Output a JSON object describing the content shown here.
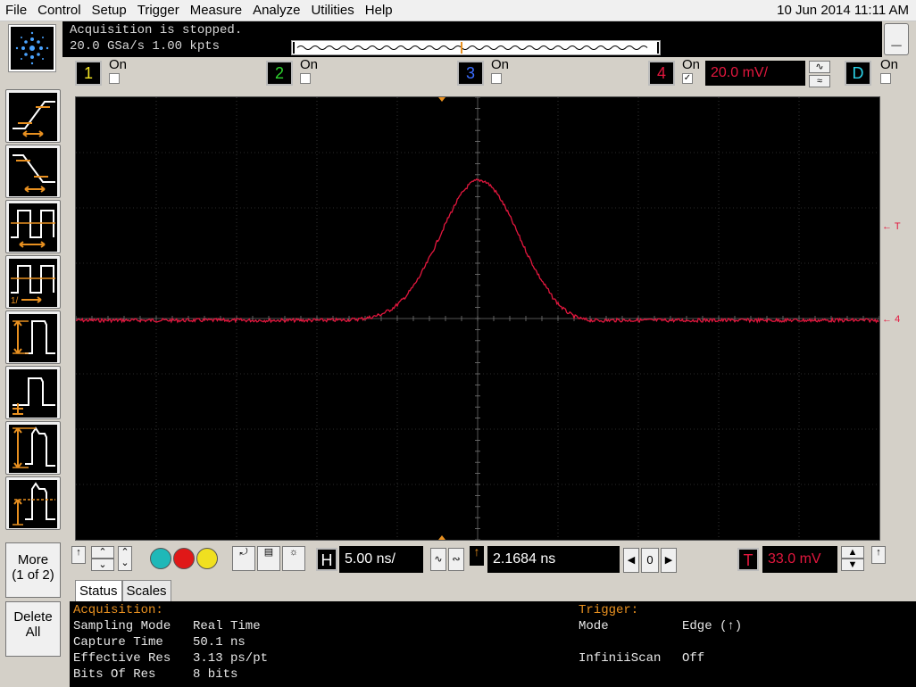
{
  "menubar": {
    "items": [
      "File",
      "Control",
      "Setup",
      "Trigger",
      "Measure",
      "Analyze",
      "Utilities",
      "Help"
    ],
    "datetime": "10 Jun 2014 11:11 AM"
  },
  "acquisition_strip": {
    "status": "Acquisition is stopped.",
    "rate": "20.0 GSa/s   1.00 kpts"
  },
  "channels": [
    {
      "id": "1",
      "label": "On",
      "checked": false,
      "color": "#f5e625"
    },
    {
      "id": "2",
      "label": "On",
      "checked": false,
      "color": "#2fd62f"
    },
    {
      "id": "3",
      "label": "On",
      "checked": false,
      "color": "#3a6cff"
    },
    {
      "id": "4",
      "label": "On",
      "checked": true,
      "color": "#e3173e",
      "scale": "20.0 mV/"
    },
    {
      "id": "D",
      "label": "On",
      "checked": false,
      "color": "#2ad2e8"
    }
  ],
  "left_toolbar": {
    "more_label_1": "More",
    "more_label_2": "(1 of 2)",
    "delete_label_1": "Delete",
    "delete_label_2": "All",
    "buttons": [
      "rise-time-icon",
      "fall-time-icon",
      "period-icon",
      "duty-cycle-icon",
      "amplitude-icon",
      "base-icon",
      "peak-to-peak-icon",
      "top-icon"
    ]
  },
  "plot": {
    "trace_color": "#e3173e",
    "grid_color": "#555555",
    "marker_color": "#e89020",
    "right_marker_trigger": "T",
    "right_marker_channel": "4"
  },
  "controls": {
    "timebase_label": "H",
    "timebase": "5.00 ns/",
    "delay": "2.1684 ns",
    "zero_label": "0",
    "trigger_label": "T",
    "trigger_level": "33.0 mV"
  },
  "tabs": [
    {
      "label": "Status",
      "active": true
    },
    {
      "label": "Scales",
      "active": false
    }
  ],
  "status": {
    "acq_title": "Acquisition:",
    "trig_title": "Trigger:",
    "rows_left": [
      {
        "k": "Sampling Mode",
        "v": "Real Time"
      },
      {
        "k": "Capture Time",
        "v": "50.1 ns"
      },
      {
        "k": "Effective Res",
        "v": "3.13 ps/pt"
      },
      {
        "k": "Bits Of Res",
        "v": "8 bits"
      }
    ],
    "rows_right": [
      {
        "k": "Mode",
        "v": "Edge (↑)"
      },
      {
        "k": "InfiniiScan",
        "v": "Off"
      }
    ]
  }
}
